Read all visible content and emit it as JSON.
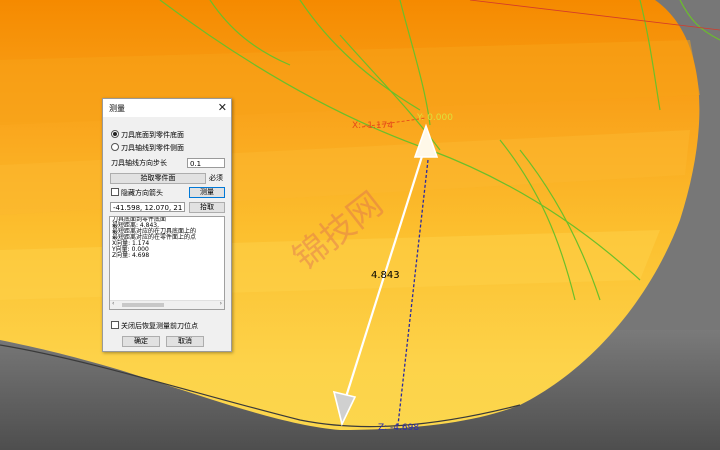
{
  "viewport": {
    "x_label": "X: -1.174",
    "y_label": "Y: 0.000",
    "z_label": "Z: -4.698",
    "distance_label": "4.843",
    "watermark": "锦技网"
  },
  "dialog": {
    "title": "测量",
    "radio_options": [
      {
        "label": "刀具底面到零件底面",
        "selected": true
      },
      {
        "label": "刀具轴线到零件侧面",
        "selected": false
      }
    ],
    "step_label": "刀具轴线方向步长",
    "step_value": "0.1",
    "pick_part_button": "拾取零件面",
    "must_label": "必须",
    "hide_arrow_label": "隐藏方向箭头",
    "measure_button": "测量",
    "coord_value": "-41.598, 12.070, 21",
    "pick_button": "拾取",
    "output_lines": [
      "刀具底面到零件底面",
      "最短距离: 4.843,",
      "最短距离对应的在刀具底面上的",
      "最短距离对应的在零件面上的点",
      "X向量: 1.174",
      "Y向量: 0.000",
      "Z向量: 4.698"
    ],
    "restore_label": "关闭后恢复测量前刀位点",
    "ok_button": "确定",
    "cancel_button": "取消"
  }
}
